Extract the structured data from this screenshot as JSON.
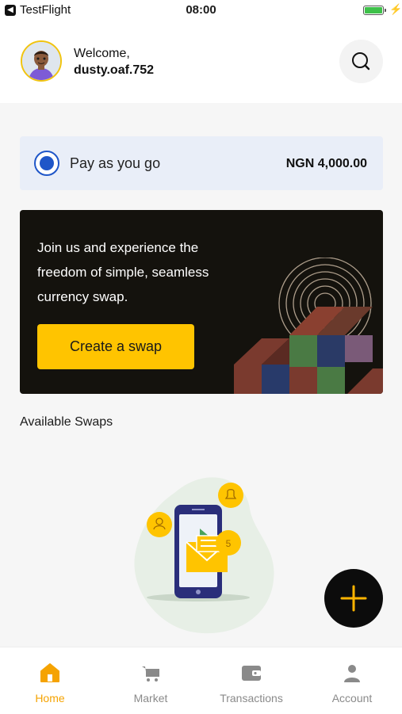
{
  "status_bar": {
    "app_name": "TestFlight",
    "time": "08:00",
    "battery_level": 1.0
  },
  "header": {
    "welcome": "Welcome,",
    "username": "dusty.oaf.752"
  },
  "plan": {
    "label": "Pay as you go",
    "amount": "NGN 4,000.00",
    "selected": true
  },
  "promo": {
    "text": "Join us and experience the freedom of simple, seamless currency swap.",
    "cta_label": "Create a swap"
  },
  "available_swaps": {
    "title": "Available Swaps",
    "notification_count": "5"
  },
  "tabs": [
    {
      "label": "Home",
      "icon": "home-icon",
      "active": true
    },
    {
      "label": "Market",
      "icon": "cart-icon",
      "active": false
    },
    {
      "label": "Transactions",
      "icon": "wallet-icon",
      "active": false
    },
    {
      "label": "Account",
      "icon": "account-icon",
      "active": false
    }
  ],
  "colors": {
    "accent": "#ffc400",
    "active_tab": "#f5a302",
    "radio": "#1f56c8",
    "promo_bg": "#14120d",
    "plan_bg": "#e9eef8"
  }
}
